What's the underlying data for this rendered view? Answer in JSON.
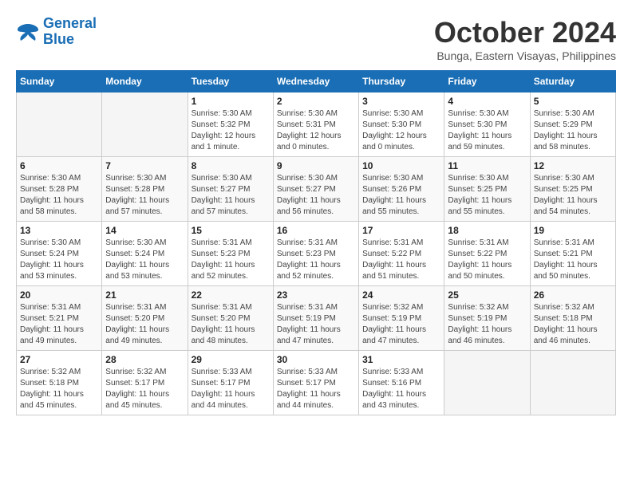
{
  "header": {
    "logo_line1": "General",
    "logo_line2": "Blue",
    "month_title": "October 2024",
    "location": "Bunga, Eastern Visayas, Philippines"
  },
  "weekdays": [
    "Sunday",
    "Monday",
    "Tuesday",
    "Wednesday",
    "Thursday",
    "Friday",
    "Saturday"
  ],
  "weeks": [
    [
      {
        "day": "",
        "sunrise": "",
        "sunset": "",
        "daylight": ""
      },
      {
        "day": "",
        "sunrise": "",
        "sunset": "",
        "daylight": ""
      },
      {
        "day": "1",
        "sunrise": "Sunrise: 5:30 AM",
        "sunset": "Sunset: 5:32 PM",
        "daylight": "Daylight: 12 hours and 1 minute."
      },
      {
        "day": "2",
        "sunrise": "Sunrise: 5:30 AM",
        "sunset": "Sunset: 5:31 PM",
        "daylight": "Daylight: 12 hours and 0 minutes."
      },
      {
        "day": "3",
        "sunrise": "Sunrise: 5:30 AM",
        "sunset": "Sunset: 5:30 PM",
        "daylight": "Daylight: 12 hours and 0 minutes."
      },
      {
        "day": "4",
        "sunrise": "Sunrise: 5:30 AM",
        "sunset": "Sunset: 5:30 PM",
        "daylight": "Daylight: 11 hours and 59 minutes."
      },
      {
        "day": "5",
        "sunrise": "Sunrise: 5:30 AM",
        "sunset": "Sunset: 5:29 PM",
        "daylight": "Daylight: 11 hours and 58 minutes."
      }
    ],
    [
      {
        "day": "6",
        "sunrise": "Sunrise: 5:30 AM",
        "sunset": "Sunset: 5:28 PM",
        "daylight": "Daylight: 11 hours and 58 minutes."
      },
      {
        "day": "7",
        "sunrise": "Sunrise: 5:30 AM",
        "sunset": "Sunset: 5:28 PM",
        "daylight": "Daylight: 11 hours and 57 minutes."
      },
      {
        "day": "8",
        "sunrise": "Sunrise: 5:30 AM",
        "sunset": "Sunset: 5:27 PM",
        "daylight": "Daylight: 11 hours and 57 minutes."
      },
      {
        "day": "9",
        "sunrise": "Sunrise: 5:30 AM",
        "sunset": "Sunset: 5:27 PM",
        "daylight": "Daylight: 11 hours and 56 minutes."
      },
      {
        "day": "10",
        "sunrise": "Sunrise: 5:30 AM",
        "sunset": "Sunset: 5:26 PM",
        "daylight": "Daylight: 11 hours and 55 minutes."
      },
      {
        "day": "11",
        "sunrise": "Sunrise: 5:30 AM",
        "sunset": "Sunset: 5:25 PM",
        "daylight": "Daylight: 11 hours and 55 minutes."
      },
      {
        "day": "12",
        "sunrise": "Sunrise: 5:30 AM",
        "sunset": "Sunset: 5:25 PM",
        "daylight": "Daylight: 11 hours and 54 minutes."
      }
    ],
    [
      {
        "day": "13",
        "sunrise": "Sunrise: 5:30 AM",
        "sunset": "Sunset: 5:24 PM",
        "daylight": "Daylight: 11 hours and 53 minutes."
      },
      {
        "day": "14",
        "sunrise": "Sunrise: 5:30 AM",
        "sunset": "Sunset: 5:24 PM",
        "daylight": "Daylight: 11 hours and 53 minutes."
      },
      {
        "day": "15",
        "sunrise": "Sunrise: 5:31 AM",
        "sunset": "Sunset: 5:23 PM",
        "daylight": "Daylight: 11 hours and 52 minutes."
      },
      {
        "day": "16",
        "sunrise": "Sunrise: 5:31 AM",
        "sunset": "Sunset: 5:23 PM",
        "daylight": "Daylight: 11 hours and 52 minutes."
      },
      {
        "day": "17",
        "sunrise": "Sunrise: 5:31 AM",
        "sunset": "Sunset: 5:22 PM",
        "daylight": "Daylight: 11 hours and 51 minutes."
      },
      {
        "day": "18",
        "sunrise": "Sunrise: 5:31 AM",
        "sunset": "Sunset: 5:22 PM",
        "daylight": "Daylight: 11 hours and 50 minutes."
      },
      {
        "day": "19",
        "sunrise": "Sunrise: 5:31 AM",
        "sunset": "Sunset: 5:21 PM",
        "daylight": "Daylight: 11 hours and 50 minutes."
      }
    ],
    [
      {
        "day": "20",
        "sunrise": "Sunrise: 5:31 AM",
        "sunset": "Sunset: 5:21 PM",
        "daylight": "Daylight: 11 hours and 49 minutes."
      },
      {
        "day": "21",
        "sunrise": "Sunrise: 5:31 AM",
        "sunset": "Sunset: 5:20 PM",
        "daylight": "Daylight: 11 hours and 49 minutes."
      },
      {
        "day": "22",
        "sunrise": "Sunrise: 5:31 AM",
        "sunset": "Sunset: 5:20 PM",
        "daylight": "Daylight: 11 hours and 48 minutes."
      },
      {
        "day": "23",
        "sunrise": "Sunrise: 5:31 AM",
        "sunset": "Sunset: 5:19 PM",
        "daylight": "Daylight: 11 hours and 47 minutes."
      },
      {
        "day": "24",
        "sunrise": "Sunrise: 5:32 AM",
        "sunset": "Sunset: 5:19 PM",
        "daylight": "Daylight: 11 hours and 47 minutes."
      },
      {
        "day": "25",
        "sunrise": "Sunrise: 5:32 AM",
        "sunset": "Sunset: 5:19 PM",
        "daylight": "Daylight: 11 hours and 46 minutes."
      },
      {
        "day": "26",
        "sunrise": "Sunrise: 5:32 AM",
        "sunset": "Sunset: 5:18 PM",
        "daylight": "Daylight: 11 hours and 46 minutes."
      }
    ],
    [
      {
        "day": "27",
        "sunrise": "Sunrise: 5:32 AM",
        "sunset": "Sunset: 5:18 PM",
        "daylight": "Daylight: 11 hours and 45 minutes."
      },
      {
        "day": "28",
        "sunrise": "Sunrise: 5:32 AM",
        "sunset": "Sunset: 5:17 PM",
        "daylight": "Daylight: 11 hours and 45 minutes."
      },
      {
        "day": "29",
        "sunrise": "Sunrise: 5:33 AM",
        "sunset": "Sunset: 5:17 PM",
        "daylight": "Daylight: 11 hours and 44 minutes."
      },
      {
        "day": "30",
        "sunrise": "Sunrise: 5:33 AM",
        "sunset": "Sunset: 5:17 PM",
        "daylight": "Daylight: 11 hours and 44 minutes."
      },
      {
        "day": "31",
        "sunrise": "Sunrise: 5:33 AM",
        "sunset": "Sunset: 5:16 PM",
        "daylight": "Daylight: 11 hours and 43 minutes."
      },
      {
        "day": "",
        "sunrise": "",
        "sunset": "",
        "daylight": ""
      },
      {
        "day": "",
        "sunrise": "",
        "sunset": "",
        "daylight": ""
      }
    ]
  ]
}
